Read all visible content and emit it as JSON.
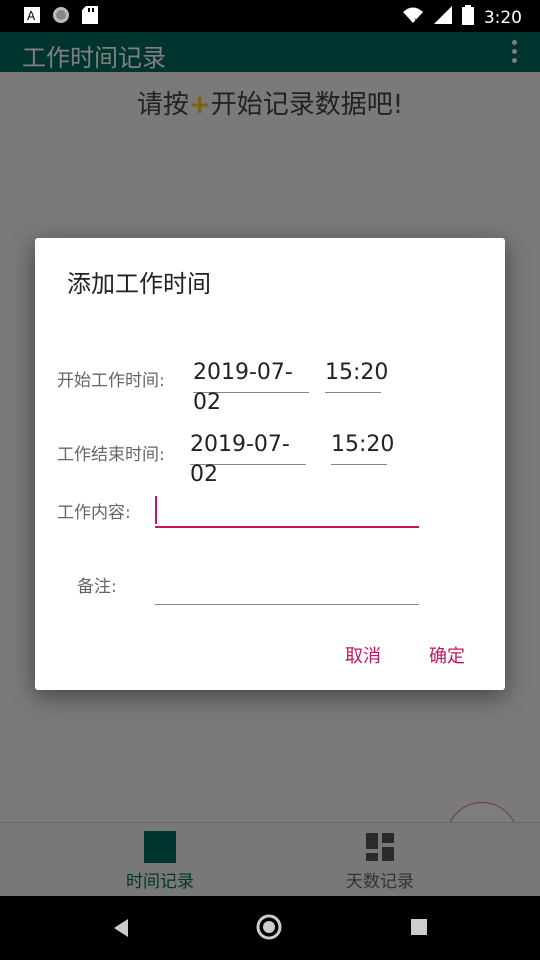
{
  "status_bar": {
    "time": "3:20",
    "left_icons": [
      "a-badge-icon",
      "circle-icon",
      "sd-card-icon"
    ],
    "right_icons": [
      "wifi-icon",
      "signal-icon",
      "battery-icon"
    ]
  },
  "app_bar": {
    "title": "工作时间记录",
    "overflow_icon": "more-vert-icon"
  },
  "main": {
    "hint_before": "请按",
    "hint_plus": "+",
    "hint_after": "开始记录数据吧!"
  },
  "fab": {
    "icon": "+"
  },
  "bottom_nav": {
    "items": [
      {
        "label": "时间记录",
        "icon": "square-icon"
      },
      {
        "label": "天数记录",
        "icon": "dashboard-icon"
      }
    ]
  },
  "dialog": {
    "title": "添加工作时间",
    "start_label": "开始工作时间:",
    "start_date": "2019-07-02",
    "start_time": "15:20",
    "end_label": "工作结束时间:",
    "end_date": "2019-07-02",
    "end_time": "15:20",
    "content_label": "工作内容:",
    "content_value": "",
    "note_label": "备注:",
    "note_value": "",
    "cancel_label": "取消",
    "confirm_label": "确定"
  },
  "colors": {
    "primary": "#00695c",
    "accent": "#c2185b",
    "fab_plus": "#43a047",
    "hint_plus": "#f0c419"
  }
}
